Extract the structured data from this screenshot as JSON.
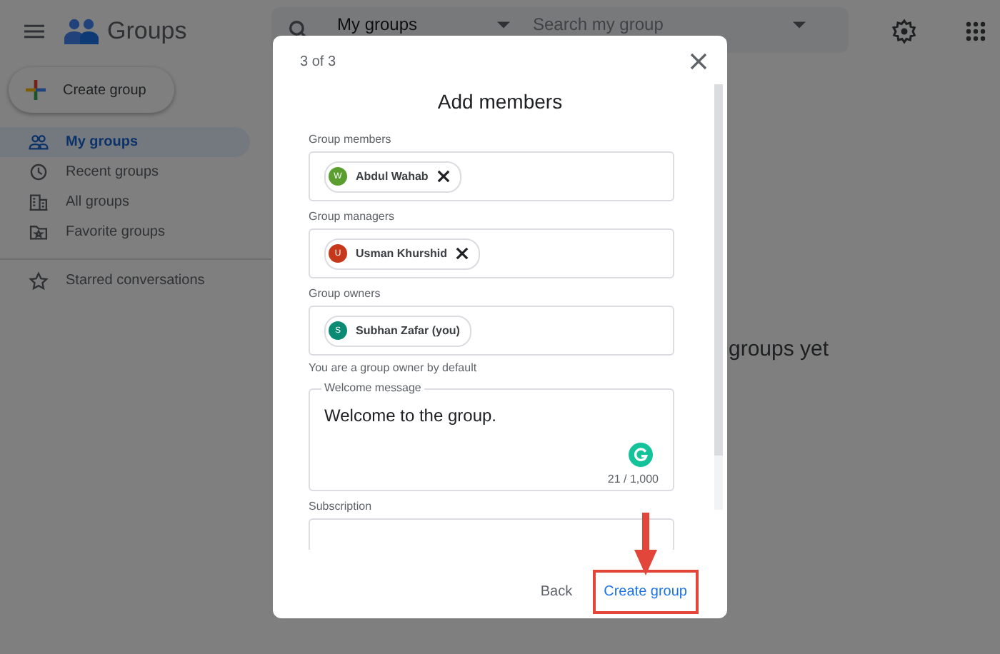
{
  "app": {
    "title": "Groups"
  },
  "search": {
    "scope": "My groups",
    "placeholder": "Search my group"
  },
  "create_button": {
    "label": "Create group"
  },
  "sidebar": {
    "items": [
      {
        "label": "My groups",
        "kind": "people",
        "selected": true
      },
      {
        "label": "Recent groups",
        "kind": "recent",
        "selected": false
      },
      {
        "label": "All groups",
        "kind": "all",
        "selected": false
      },
      {
        "label": "Favorite groups",
        "kind": "favorite",
        "selected": false
      }
    ],
    "secondary": [
      {
        "label": "Starred conversations",
        "kind": "starred",
        "selected": false
      }
    ]
  },
  "main": {
    "empty_text": "groups yet"
  },
  "dialog": {
    "step": "3 of 3",
    "title": "Add members",
    "fields": [
      {
        "label": "Group members",
        "chips": [
          {
            "initial": "W",
            "name": "Abdul Wahab",
            "color": "#5a9e2f",
            "removable": true
          }
        ]
      },
      {
        "label": "Group managers",
        "chips": [
          {
            "initial": "U",
            "name": "Usman Khurshid",
            "color": "#c7381a",
            "removable": true
          }
        ]
      },
      {
        "label": "Group owners",
        "chips": [
          {
            "initial": "S",
            "name": "Subhan Zafar (you)",
            "color": "#0b8a74",
            "removable": false
          }
        ],
        "hint": "You are a group owner by default"
      }
    ],
    "welcome": {
      "label": "Welcome message",
      "value": "Welcome to the group.",
      "counter": "21 / 1,000"
    },
    "subscription": {
      "label": "Subscription"
    },
    "buttons": [
      {
        "label": "Back",
        "kind": "text",
        "highlighted": false
      },
      {
        "label": "Create group",
        "kind": "primary",
        "highlighted": true
      }
    ]
  }
}
